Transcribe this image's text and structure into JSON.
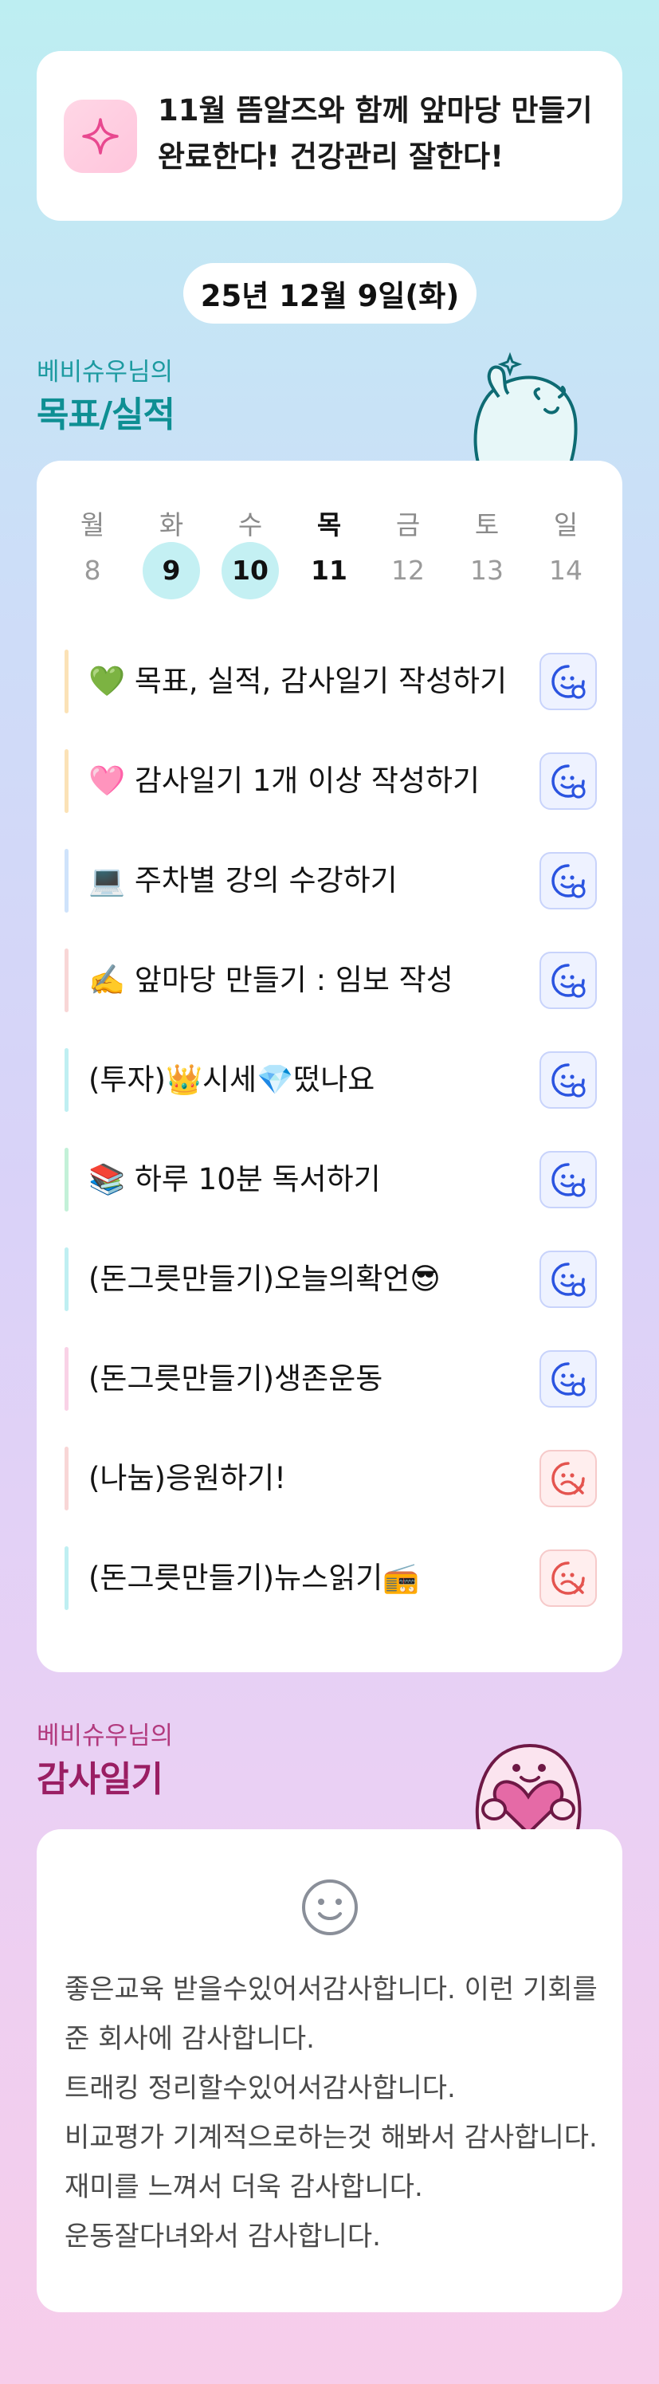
{
  "banner": {
    "icon": "sparkle-icon",
    "message": "11월 뜸알즈와 함께 앞마당 만들기 완료한다! 건강관리 잘한다!"
  },
  "date": "25년 12월 9일(화)",
  "goals": {
    "owner": "베비슈우님의",
    "title": "목표/실적"
  },
  "week": {
    "days": [
      "월",
      "화",
      "수",
      "목",
      "금",
      "토",
      "일"
    ],
    "dates": [
      "8",
      "9",
      "10",
      "11",
      "12",
      "13",
      "14"
    ],
    "highlighted": [
      "9",
      "10"
    ],
    "today": "11"
  },
  "tasks": [
    {
      "label": "💚 목표, 실적, 감사일기 작성하기",
      "bar": "#fbe2b6",
      "status": "done"
    },
    {
      "label": "🩷 감사일기 1개 이상 작성하기",
      "bar": "#fbe2b6",
      "status": "done"
    },
    {
      "label": "💻 주차별 강의 수강하기",
      "bar": "#cfe3fb",
      "status": "done"
    },
    {
      "label": "✍️ 앞마당 만들기 : 임보 작성",
      "bar": "#f8d6d6",
      "status": "done"
    },
    {
      "label": "(투자)👑시세💎떴나요",
      "bar": "#bfeff2",
      "status": "done"
    },
    {
      "label": "📚 하루 10분 독서하기",
      "bar": "#c3f1d8",
      "status": "done"
    },
    {
      "label": "(돈그릇만들기)오늘의확언😎",
      "bar": "#bfeff2",
      "status": "done"
    },
    {
      "label": "(돈그릇만들기)생존운동",
      "bar": "#f9d2e6",
      "status": "done"
    },
    {
      "label": "(나눔)응원하기!",
      "bar": "#f8d6d6",
      "status": "fail"
    },
    {
      "label": "(돈그릇만들기)뉴스읽기📻",
      "bar": "#bfeff2",
      "status": "fail"
    }
  ],
  "gratitude": {
    "owner": "베비슈우님의",
    "title": "감사일기",
    "icon": "smile-icon",
    "text": "좋은교육 받을수있어서감사합니다. 이런 기회를준 회사에 감사합니다.\n트래킹 정리할수있어서감사합니다.\n비교평가 기계적으로하는것 해봐서 감사합니다. 재미를 느껴서 더욱 감사합니다.\n운동잘다녀와서 감사합니다."
  },
  "colors": {
    "done": "#2b54e0",
    "fail": "#e4544f",
    "goal_accent": "#0e8f93",
    "grat_accent": "#9a1e63"
  }
}
